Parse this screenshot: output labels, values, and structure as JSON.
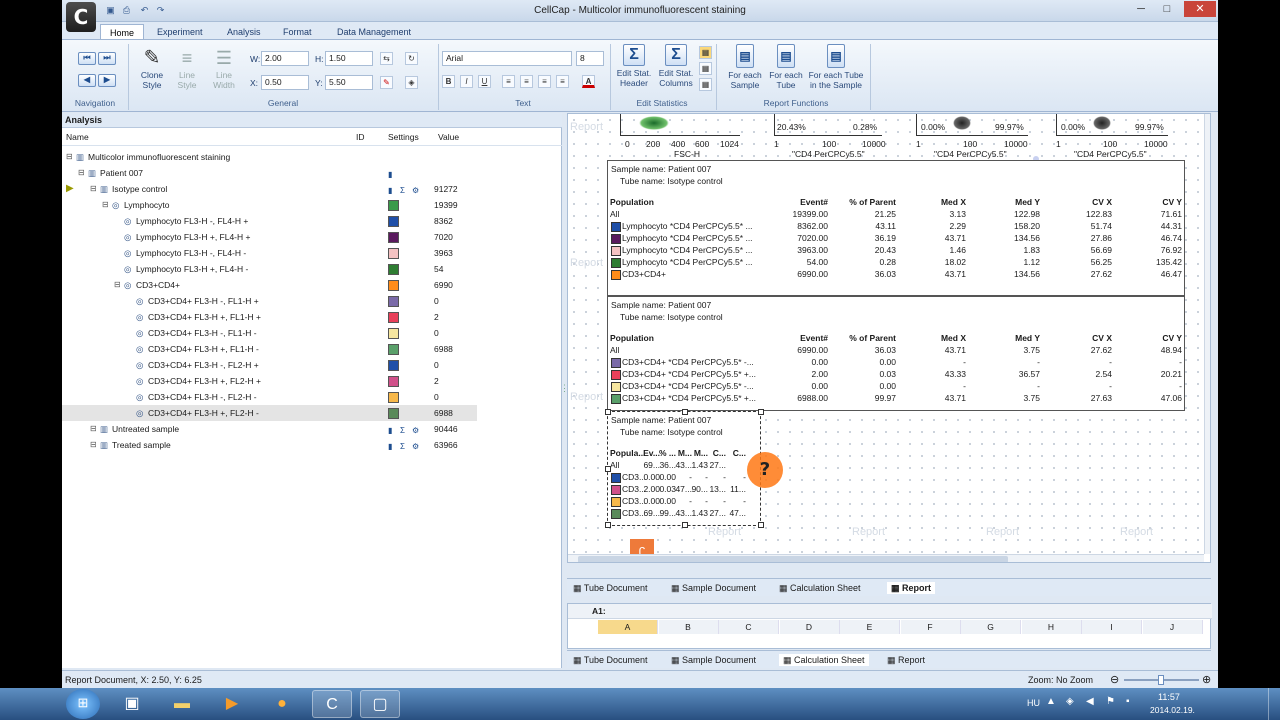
{
  "window": {
    "title": "CellCap - Multicolor immunofluorescent staining",
    "app_letter": "C"
  },
  "tabs": [
    "Home",
    "Experiment",
    "Analysis",
    "Format",
    "Data Management"
  ],
  "ribbon": {
    "navigation_label": "Navigation",
    "general": {
      "label": "General",
      "clone": "Clone Style",
      "line_style": "Line Style",
      "line_width": "Line Width",
      "w_label": "W:",
      "w": "2.00",
      "h_label": "H:",
      "h": "1.50",
      "x_label": "X:",
      "x": "0.50",
      "y_label": "Y:",
      "y": "5.50"
    },
    "text": {
      "label": "Text",
      "font": "Arial",
      "size": "8",
      "bold": "B",
      "italic": "I",
      "underline": "U"
    },
    "edit_statistics": {
      "label": "Edit Statistics",
      "header": "Edit Stat. Header",
      "columns": "Edit Stat. Columns"
    },
    "report_functions": {
      "label": "Report Functions",
      "each_sample": "For each Sample",
      "each_tube": "For each Tube",
      "each_tube_in_sample": "For each Tube in the Sample"
    }
  },
  "analysis": {
    "title": "Analysis",
    "columns": {
      "name": "Name",
      "id": "ID",
      "settings": "Settings",
      "value": "Value"
    },
    "rows": [
      {
        "label": "Multicolor immunofluorescent staining",
        "indent": 0,
        "value": "",
        "color": ""
      },
      {
        "label": "Patient 007",
        "indent": 1,
        "value": "",
        "color": "",
        "doc": true
      },
      {
        "label": "Isotype control",
        "indent": 2,
        "value": "91272",
        "color": "",
        "stats": true
      },
      {
        "label": "Lymphocyto",
        "indent": 3,
        "value": "19399",
        "color": "#3a9a4a"
      },
      {
        "label": "Lymphocyto FL3-H -, FL4-H +",
        "indent": 4,
        "value": "8362",
        "color": "#1f4fa8"
      },
      {
        "label": "Lymphocyto FL3-H +, FL4-H +",
        "indent": 4,
        "value": "7020",
        "color": "#5a1a5e"
      },
      {
        "label": "Lymphocyto FL3-H -, FL4-H -",
        "indent": 4,
        "value": "3963",
        "color": "#f4c2c2"
      },
      {
        "label": "Lymphocyto FL3-H +, FL4-H -",
        "indent": 4,
        "value": "54",
        "color": "#2e7d32"
      },
      {
        "label": "CD3+CD4+",
        "indent": 4,
        "value": "6990",
        "color": "#ff8c1a"
      },
      {
        "label": "CD3+CD4+ FL3-H -, FL1-H +",
        "indent": 5,
        "value": "0",
        "color": "#7a6aa8"
      },
      {
        "label": "CD3+CD4+ FL3-H +, FL1-H +",
        "indent": 5,
        "value": "2",
        "color": "#e8405a"
      },
      {
        "label": "CD3+CD4+ FL3-H -, FL1-H -",
        "indent": 5,
        "value": "0",
        "color": "#f7e7a0"
      },
      {
        "label": "CD3+CD4+ FL3-H +, FL1-H -",
        "indent": 5,
        "value": "6988",
        "color": "#5aa06a"
      },
      {
        "label": "CD3+CD4+ FL3-H -, FL2-H +",
        "indent": 5,
        "value": "0",
        "color": "#1f4fa8"
      },
      {
        "label": "CD3+CD4+ FL3-H +, FL2-H +",
        "indent": 5,
        "value": "2",
        "color": "#d0508a"
      },
      {
        "label": "CD3+CD4+ FL3-H -, FL2-H -",
        "indent": 5,
        "value": "0",
        "color": "#f7b84a"
      },
      {
        "label": "CD3+CD4+ FL3-H +, FL2-H -",
        "indent": 5,
        "value": "6988",
        "color": "#5a8a5a"
      },
      {
        "label": "Untreated sample",
        "indent": 2,
        "value": "90446",
        "color": "",
        "stats": true
      },
      {
        "label": "Treated sample",
        "indent": 2,
        "value": "63966",
        "color": "",
        "stats": true
      }
    ]
  },
  "report": {
    "watermark": "Report",
    "plots": {
      "x1_ticks": [
        "0",
        "200",
        "400",
        "600",
        "1024"
      ],
      "x1_label": "FSC-H",
      "log_ticks": [
        "1",
        "100",
        "10000"
      ],
      "axis_label": "\"CD4 PerCPCy5.5\"",
      "q1": "20.43%",
      "q2": "0.28%",
      "q3": "0.00%",
      "q4": "99.97%",
      "q5": "0.00%",
      "q6": "99.97%"
    },
    "table1": {
      "sample": "Sample name: Patient 007",
      "tube": "Tube name: Isotype control",
      "headers": [
        "Population",
        "Event#",
        "% of Parent",
        "Med X",
        "Med Y",
        "CV X",
        "CV Y"
      ],
      "rows": [
        {
          "name": "All",
          "color": "",
          "v": [
            "19399.00",
            "21.25",
            "3.13",
            "122.98",
            "122.83",
            "71.61"
          ]
        },
        {
          "name": "Lymphocyto *CD4 PerCPCy5.5* ...",
          "color": "#1f4fa8",
          "v": [
            "8362.00",
            "43.11",
            "2.29",
            "158.20",
            "51.74",
            "44.31"
          ]
        },
        {
          "name": "Lymphocyto *CD4 PerCPCy5.5* ...",
          "color": "#5a1a5e",
          "v": [
            "7020.00",
            "36.19",
            "43.71",
            "134.56",
            "27.86",
            "46.74"
          ]
        },
        {
          "name": "Lymphocyto *CD4 PerCPCy5.5* ...",
          "color": "#f4c2c2",
          "v": [
            "3963.00",
            "20.43",
            "1.46",
            "1.83",
            "56.69",
            "76.92"
          ]
        },
        {
          "name": "Lymphocyto *CD4 PerCPCy5.5* ...",
          "color": "#2e7d32",
          "v": [
            "54.00",
            "0.28",
            "18.02",
            "1.12",
            "56.25",
            "135.42"
          ]
        },
        {
          "name": "CD3+CD4+",
          "color": "#ff8c1a",
          "v": [
            "6990.00",
            "36.03",
            "43.71",
            "134.56",
            "27.62",
            "46.47"
          ]
        }
      ]
    },
    "table2": {
      "sample": "Sample name: Patient 007",
      "tube": "Tube name: Isotype control",
      "headers": [
        "Population",
        "Event#",
        "% of Parent",
        "Med X",
        "Med Y",
        "CV X",
        "CV Y"
      ],
      "rows": [
        {
          "name": "All",
          "color": "",
          "v": [
            "6990.00",
            "36.03",
            "43.71",
            "3.75",
            "27.62",
            "48.94"
          ]
        },
        {
          "name": "CD3+CD4+ *CD4 PerCPCy5.5* -...",
          "color": "#7a6aa8",
          "v": [
            "0.00",
            "0.00",
            "-",
            "-",
            "-",
            "-"
          ]
        },
        {
          "name": "CD3+CD4+ *CD4 PerCPCy5.5* +...",
          "color": "#e8405a",
          "v": [
            "2.00",
            "0.03",
            "43.33",
            "36.57",
            "2.54",
            "20.21"
          ]
        },
        {
          "name": "CD3+CD4+ *CD4 PerCPCy5.5* -...",
          "color": "#f7e7a0",
          "v": [
            "0.00",
            "0.00",
            "-",
            "-",
            "-",
            "-"
          ]
        },
        {
          "name": "CD3+CD4+ *CD4 PerCPCy5.5* +...",
          "color": "#5aa06a",
          "v": [
            "6988.00",
            "99.97",
            "43.71",
            "3.75",
            "27.63",
            "47.06"
          ]
        }
      ]
    },
    "table3": {
      "sample": "Sample name: Patient 007",
      "tube": "Tube name: Isotype control",
      "headers": [
        "Popula...",
        "Ev...",
        "% ...",
        "M...",
        "M...",
        "C...",
        "C..."
      ],
      "rows": [
        {
          "name": "All",
          "color": "",
          "v": [
            "69...",
            "36...",
            "43...",
            "1.43",
            "27...",
            ""
          ]
        },
        {
          "name": "CD3...",
          "color": "#1f4fa8",
          "v": [
            "0.00",
            "0.00",
            "-",
            "-",
            "-",
            "-"
          ]
        },
        {
          "name": "CD3...",
          "color": "#d0508a",
          "v": [
            "2.00",
            "0.03",
            "47...",
            "90...",
            "13...",
            "11..."
          ]
        },
        {
          "name": "CD3...",
          "color": "#f7b84a",
          "v": [
            "0.00",
            "0.00",
            "-",
            "-",
            "-",
            "-"
          ]
        },
        {
          "name": "CD3...",
          "color": "#5a8a5a",
          "v": [
            "69...",
            "99...",
            "43...",
            "1.43",
            "27...",
            "47..."
          ]
        }
      ]
    }
  },
  "doc_tabs": [
    "Tube Document",
    "Sample Document",
    "Calculation Sheet",
    "Report"
  ],
  "sheet": {
    "cell_ref": "A1:",
    "columns": [
      "A",
      "B",
      "C",
      "D",
      "E",
      "F",
      "G",
      "H",
      "I",
      "J"
    ]
  },
  "status": {
    "left": "Report Document, X: 2.50, Y: 6.25",
    "zoom": "Zoom: No Zoom"
  },
  "tray": {
    "lang": "HU",
    "time": "11:57",
    "date": "2014.02.19."
  }
}
